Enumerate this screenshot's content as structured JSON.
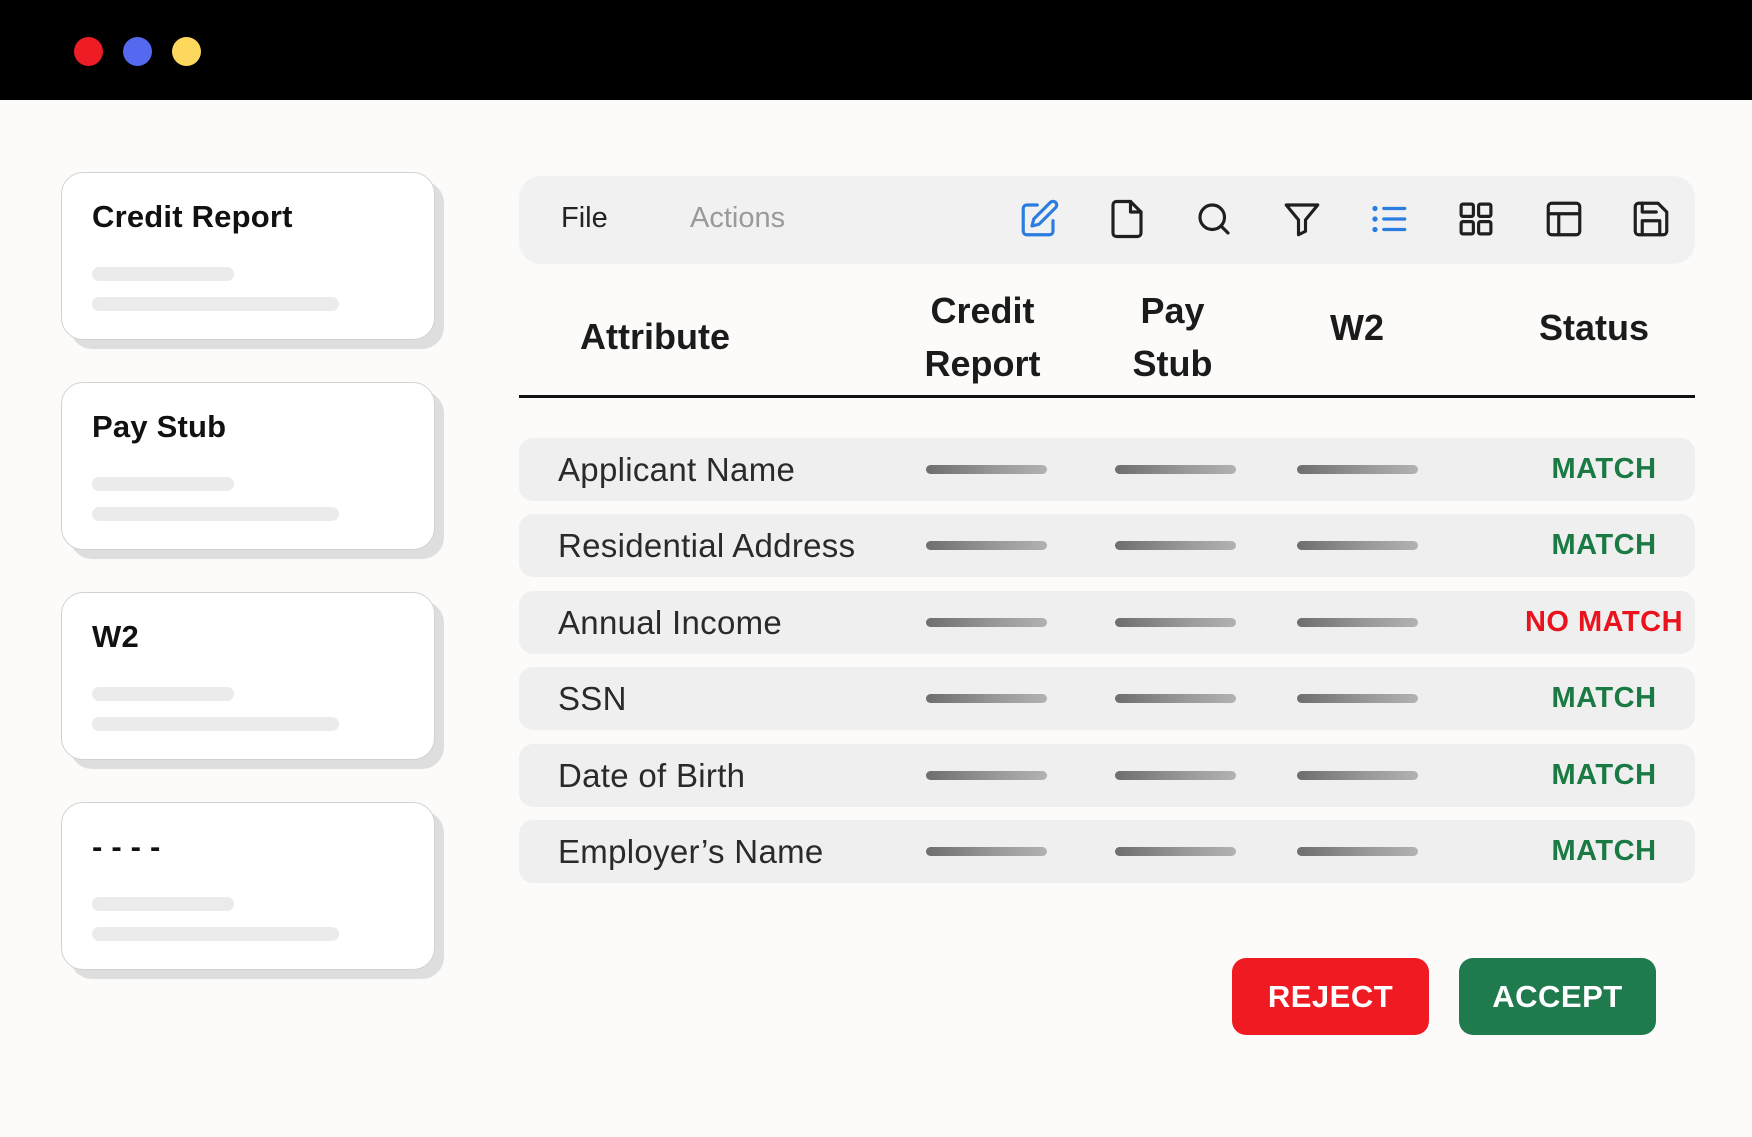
{
  "window": {
    "controls": [
      "close-dot",
      "minimize-dot",
      "maximize-dot"
    ]
  },
  "colors": {
    "match": "#1b7a43",
    "no_match": "#e8131c",
    "accent_icon": "#2b7ce0",
    "reject": "#f01b22",
    "accept": "#1f7a4d"
  },
  "sidebar": {
    "cards": [
      {
        "title": "Credit Report"
      },
      {
        "title": "Pay Stub"
      },
      {
        "title": "W2"
      },
      {
        "title": "- - - -"
      }
    ]
  },
  "toolbar": {
    "menu": {
      "file": "File",
      "actions": "Actions"
    },
    "icons": [
      "edit-icon",
      "document-icon",
      "search-icon",
      "filter-icon",
      "list-icon",
      "grid-icon",
      "layout-icon",
      "save-icon"
    ]
  },
  "table": {
    "headers": {
      "attribute": "Attribute",
      "credit_report_1": "Credit",
      "credit_report_2": "Report",
      "pay_stub_1": "Pay",
      "pay_stub_2": "Stub",
      "w2": "W2",
      "status": "Status"
    },
    "rows": [
      {
        "attribute": "Applicant Name",
        "status": "MATCH",
        "match": true
      },
      {
        "attribute": "Residential Address",
        "status": "MATCH",
        "match": true
      },
      {
        "attribute": "Annual Income",
        "status": "NO MATCH",
        "match": false
      },
      {
        "attribute": "SSN",
        "status": "MATCH",
        "match": true
      },
      {
        "attribute": "Date of Birth",
        "status": "MATCH",
        "match": true
      },
      {
        "attribute": "Employer’s Name",
        "status": "MATCH",
        "match": true
      }
    ]
  },
  "actions": {
    "reject_label": "REJECT",
    "accept_label": "ACCEPT"
  }
}
